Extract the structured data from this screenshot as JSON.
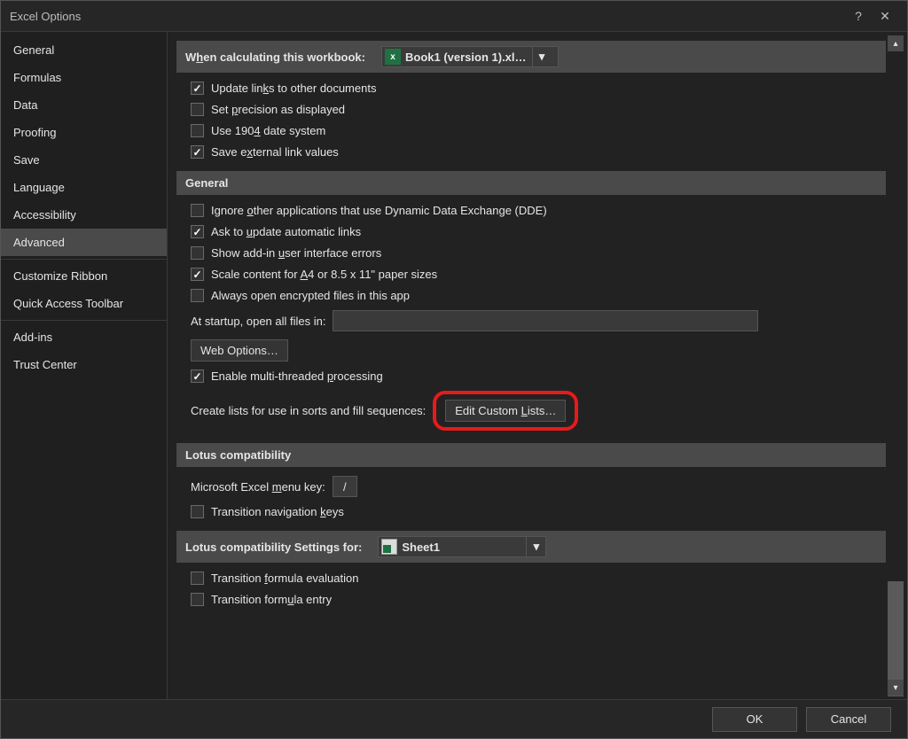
{
  "title": "Excel Options",
  "help_icon": "?",
  "sidebar": {
    "items": [
      {
        "label": "General"
      },
      {
        "label": "Formulas"
      },
      {
        "label": "Data"
      },
      {
        "label": "Proofing"
      },
      {
        "label": "Save"
      },
      {
        "label": "Language"
      },
      {
        "label": "Accessibility"
      },
      {
        "label": "Advanced",
        "selected": true
      },
      {
        "label": "Customize Ribbon"
      },
      {
        "label": "Quick Access Toolbar"
      },
      {
        "label": "Add-ins"
      },
      {
        "label": "Trust Center"
      }
    ]
  },
  "calc": {
    "heading_prefix": "W",
    "heading_u": "h",
    "heading_rest": "en calculating this workbook:",
    "workbook": "Book1 (version 1).xl…",
    "update_links_pre": "Update lin",
    "update_links_u": "k",
    "update_links_post": "s to other documents",
    "update_links_checked": true,
    "precision_pre": "Set ",
    "precision_u": "p",
    "precision_post": "recision as displayed",
    "precision_checked": false,
    "date_pre": "Use 190",
    "date_u": "4",
    "date_post": " date system",
    "date_checked": false,
    "save_ext_pre": "Save e",
    "save_ext_u": "x",
    "save_ext_post": "ternal link values",
    "save_ext_checked": true
  },
  "general": {
    "heading": "General",
    "dde_pre": "Ignore ",
    "dde_u": "o",
    "dde_post": "ther applications that use Dynamic Data Exchange (DDE)",
    "dde_checked": false,
    "ask_pre": "Ask to ",
    "ask_u": "u",
    "ask_post": "pdate automatic links",
    "ask_checked": true,
    "addin_pre": "Show add-in ",
    "addin_u": "u",
    "addin_post": "ser interface errors",
    "addin_checked": false,
    "scale_pre": "Scale content for ",
    "scale_u": "A",
    "scale_post": "4 or 8.5 x 11\" paper sizes",
    "scale_checked": true,
    "encrypted": "Always open encrypted files in this app",
    "encrypted_checked": false,
    "startup_label": "At startup, open all files in:",
    "startup_value": "",
    "web_options": "Web Options…",
    "multithread_pre": "Enable multi-threaded ",
    "multithread_u": "p",
    "multithread_post": "rocessing",
    "multithread_checked": true,
    "sorts_label": "Create lists for use in sorts and fill sequences:",
    "edit_custom_pre": "Edit Custom ",
    "edit_custom_u": "L",
    "edit_custom_post": "ists…"
  },
  "lotus1": {
    "heading": "Lotus compatibility",
    "menu_pre": "Microsoft Excel ",
    "menu_u": "m",
    "menu_post": "enu key:",
    "menu_value": "/",
    "nav_pre": "Transition navigation ",
    "nav_u": "k",
    "nav_post": "eys",
    "nav_checked": false
  },
  "lotus2": {
    "heading": "Lotus compatibility Settings for:",
    "sheet": "Sheet1",
    "feval_pre": "Transition ",
    "feval_u": "f",
    "feval_post": "ormula evaluation",
    "feval_checked": false,
    "fentry_pre": "Transition form",
    "fentry_u": "u",
    "fentry_post": "la entry",
    "fentry_checked": false
  },
  "footer": {
    "ok": "OK",
    "cancel": "Cancel"
  }
}
